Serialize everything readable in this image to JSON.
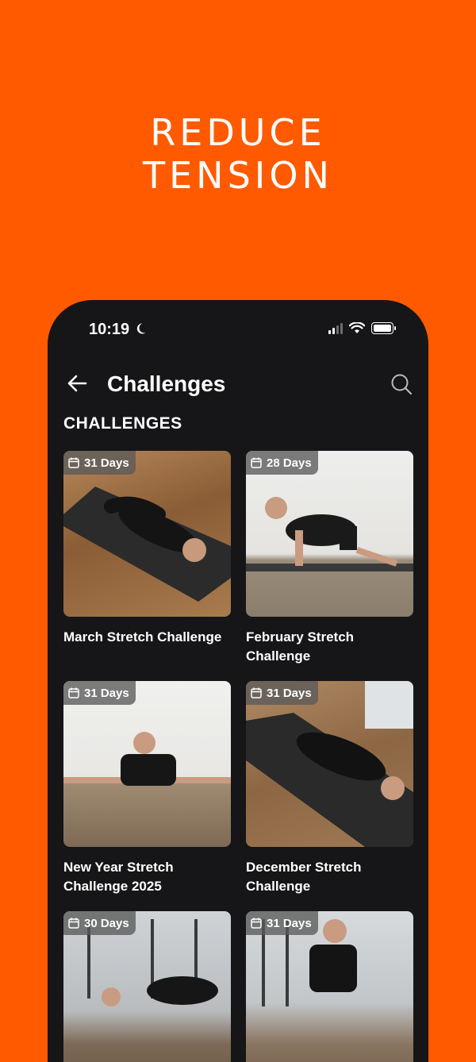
{
  "headline": {
    "line1": "REDUCE",
    "line2": "TENSION"
  },
  "status_bar": {
    "time": "10:19"
  },
  "nav": {
    "title": "Challenges"
  },
  "section_title": "CHALLENGES",
  "cards": [
    {
      "days": "31 Days",
      "title": "March Stretch Challenge"
    },
    {
      "days": "28 Days",
      "title": "February Stretch Challenge"
    },
    {
      "days": "31 Days",
      "title": "New Year Stretch Challenge 2025"
    },
    {
      "days": "31 Days",
      "title": "December Stretch Challenge"
    },
    {
      "days": "30 Days",
      "title": ""
    },
    {
      "days": "31 Days",
      "title": ""
    }
  ],
  "colors": {
    "brand_orange": "#FF5A00",
    "app_background": "#161618"
  },
  "icons": [
    "moon-icon",
    "signal-icon",
    "wifi-icon",
    "battery-icon",
    "back-arrow-icon",
    "search-icon",
    "calendar-icon"
  ]
}
